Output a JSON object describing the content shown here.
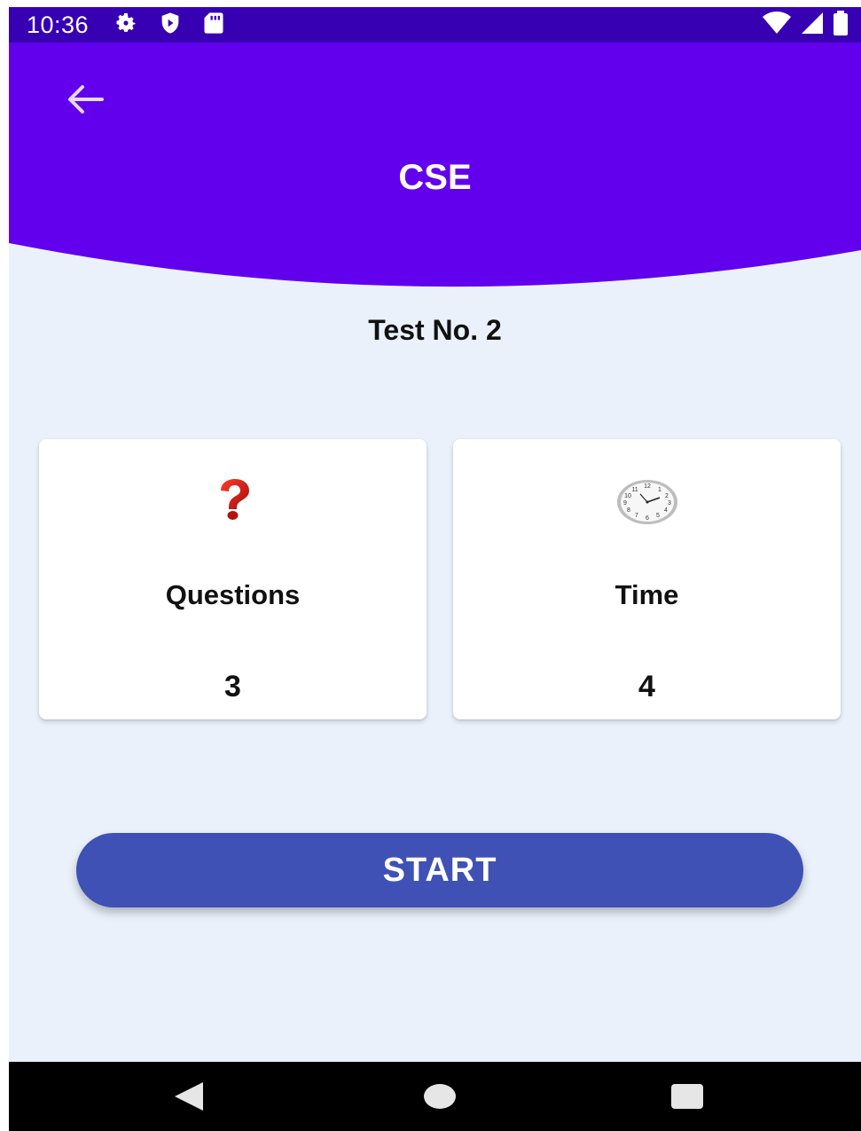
{
  "status_bar": {
    "time": "10:36",
    "icons_left": [
      "gear-icon",
      "shield-play-icon",
      "sd-card-icon"
    ],
    "icons_right": [
      "wifi-icon",
      "signal-icon",
      "battery-icon"
    ]
  },
  "header": {
    "title": "CSE",
    "background_color": "#6200ee",
    "back_icon": "arrow-left-icon"
  },
  "test": {
    "title": "Test No. 2"
  },
  "cards": {
    "questions": {
      "icon": "question-mark-icon",
      "label": "Questions",
      "value": "3"
    },
    "time": {
      "icon": "clock-icon",
      "label": "Time",
      "value": "4"
    }
  },
  "start_button": {
    "label": "START",
    "color": "#3f51b5"
  },
  "nav_bar": {
    "icons": [
      "nav-back-icon",
      "nav-home-icon",
      "nav-recents-icon"
    ]
  }
}
